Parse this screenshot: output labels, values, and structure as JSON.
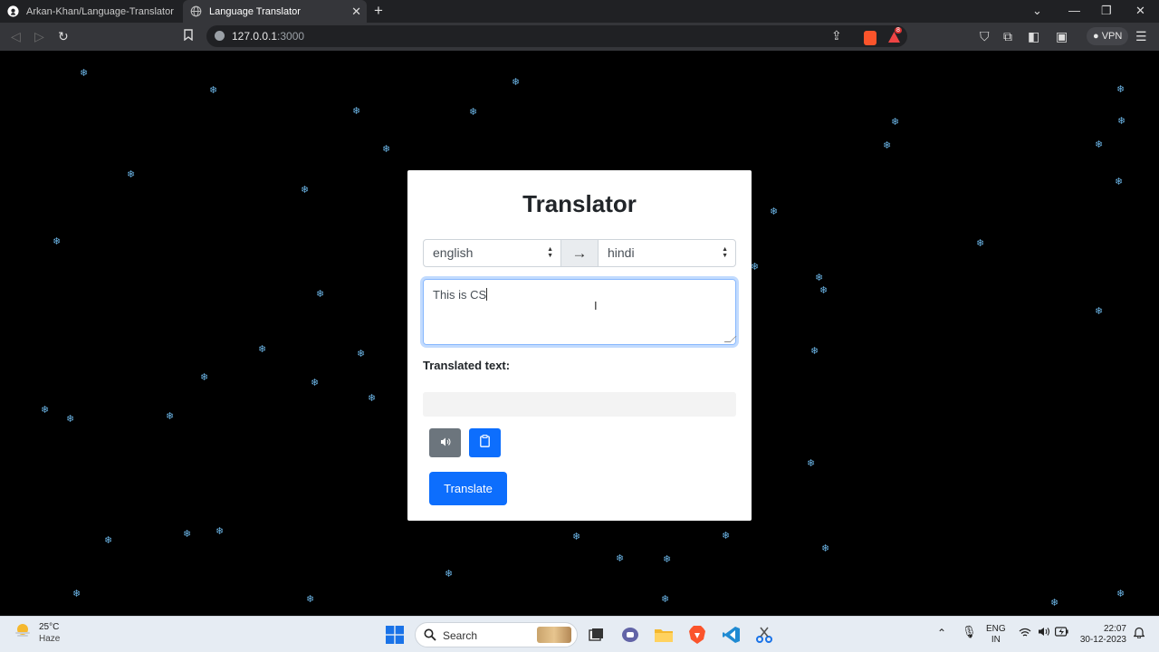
{
  "browser": {
    "tabs": [
      {
        "label": "Arkan-Khan/Language-Translator",
        "icon": "github-icon"
      },
      {
        "label": "Language Translator",
        "icon": "globe-icon",
        "active": true
      }
    ],
    "url_host": "127.0.0.1",
    "url_port": ":3000",
    "vpn_label": "VPN",
    "rewards_badge": "8"
  },
  "app": {
    "title": "Translator",
    "from_language": "english",
    "to_language": "hindi",
    "input_text": "This is CS",
    "translated_label": "Translated text:",
    "translated_text": "",
    "translate_button": "Translate"
  },
  "taskbar": {
    "temperature": "25°C",
    "weather": "Haze",
    "search_label": "Search",
    "lang_line1": "ENG",
    "lang_line2": "IN",
    "time": "22:07",
    "date": "30-12-2023"
  },
  "colors": {
    "primary": "#0d6efd",
    "secondary": "#6c757d",
    "snowflake": "#6cb6e8",
    "page_bg": "#000000"
  }
}
